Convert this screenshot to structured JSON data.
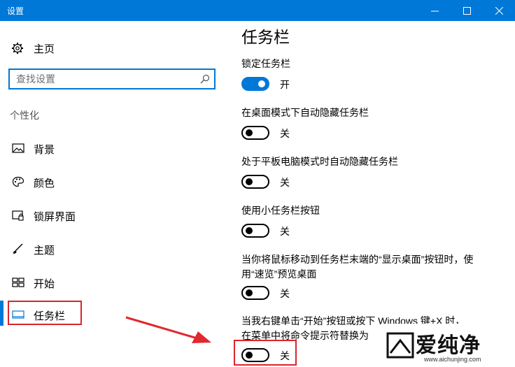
{
  "window": {
    "title": "设置"
  },
  "sidebar": {
    "home_label": "主页",
    "search_placeholder": "查找设置",
    "section_label": "个性化",
    "items": [
      {
        "label": "背景",
        "icon": "picture-icon"
      },
      {
        "label": "颜色",
        "icon": "palette-icon"
      },
      {
        "label": "锁屏界面",
        "icon": "lock-screen-icon"
      },
      {
        "label": "主题",
        "icon": "brush-icon"
      },
      {
        "label": "开始",
        "icon": "start-grid-icon"
      },
      {
        "label": "任务栏",
        "icon": "taskbar-icon",
        "active": true
      }
    ]
  },
  "main": {
    "heading": "任务栏",
    "settings": [
      {
        "label": "锁定任务栏",
        "state": "开",
        "on": true
      },
      {
        "label": "在桌面模式下自动隐藏任务栏",
        "state": "关",
        "on": false
      },
      {
        "label": "处于平板电脑模式时自动隐藏任务栏",
        "state": "关",
        "on": false
      },
      {
        "label": "使用小任务栏按钮",
        "state": "关",
        "on": false
      },
      {
        "label_line1": "当你将鼠标移动到任务栏末端的“显示桌面”按钮时，使",
        "label_line2": "用“速览”预览桌面",
        "state": "关",
        "on": false
      },
      {
        "label_line1": "当我右键单击“开始”按钮或按下 Windows 键+X 时，",
        "label_line2": "在菜单中将命令提示符替换为",
        "state": "关",
        "on": false
      }
    ]
  },
  "watermark": {
    "brand": "爱纯净",
    "url": "www.aichunjing.com"
  },
  "colors": {
    "accent": "#0078d7",
    "highlight": "#d9262b",
    "arrow": "#e0282e"
  }
}
